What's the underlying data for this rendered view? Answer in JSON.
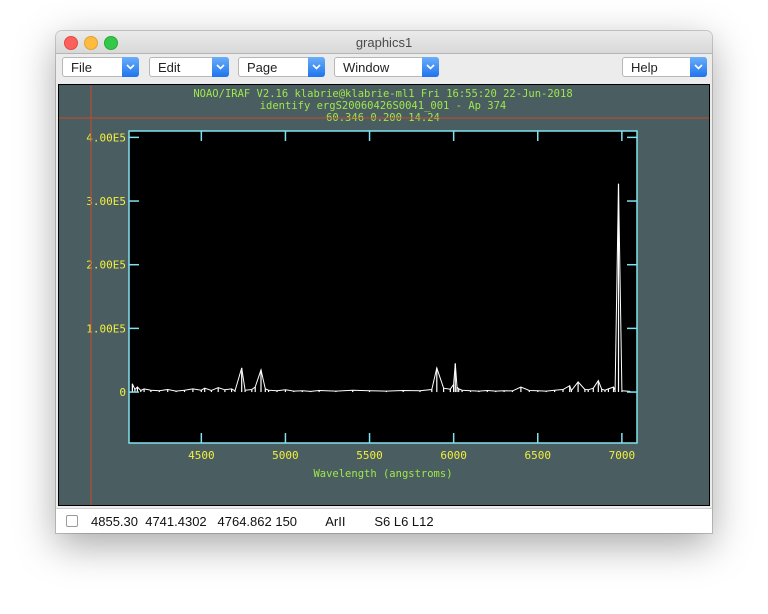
{
  "window": {
    "title": "graphics1"
  },
  "menus": [
    {
      "label": "File"
    },
    {
      "label": "Edit"
    },
    {
      "label": "Page"
    },
    {
      "label": "Window"
    },
    {
      "label": "Help"
    }
  ],
  "plot_header": {
    "line1": "NOAO/IRAF V2.16 klabrie@klabrie-ml1 Fri 16:55:20 22-Jun-2018",
    "line2": "identify ergS20060426S0041_001 - Ap 374",
    "line3": "60.346   0.200 14.24"
  },
  "colors": {
    "plot_background": "#4a5e61",
    "axes_frame": "#7fe3ef",
    "header_text": "#9fe84a",
    "tick_labels": "#f2ef3c",
    "spectrum": "#ffffff",
    "cursor": "#c44a2a"
  },
  "chart_data": {
    "type": "line",
    "xlabel": "Wavelength (angstroms)",
    "ylabel": "",
    "xlim": [
      4070,
      7090
    ],
    "ylim": [
      -80000,
      410000
    ],
    "x_ticks": [
      4500,
      5000,
      5500,
      6000,
      6500,
      7000
    ],
    "x_tick_labels": [
      "4500",
      "5000",
      "5500",
      "6000",
      "6500",
      "7000"
    ],
    "y_ticks": [
      0,
      100000,
      200000,
      300000,
      400000
    ],
    "y_tick_labels": [
      "0",
      "1.00E5",
      "2.00E5",
      "3.00E5",
      "4.00E5"
    ],
    "grid": false,
    "series": [
      {
        "x": [
          4090,
          4105,
          4120,
          4140,
          4160,
          4200,
          4250,
          4300,
          4350,
          4400,
          4450,
          4500,
          4520,
          4560,
          4600,
          4640,
          4680,
          4700,
          4740,
          4760,
          4800,
          4820,
          4855,
          4880,
          4900,
          4950,
          5000,
          5050,
          5100,
          5150,
          5200,
          5300,
          5400,
          5500,
          5600,
          5700,
          5800,
          5870,
          5900,
          5940,
          5980,
          6000,
          6010,
          6020,
          6030,
          6050,
          6100,
          6150,
          6200,
          6250,
          6300,
          6350,
          6400,
          6450,
          6500,
          6550,
          6600,
          6650,
          6690,
          6700,
          6740,
          6780,
          6800,
          6830,
          6860,
          6880,
          6900,
          6920,
          6950,
          6960,
          6980,
          7000,
          7050
        ],
        "y": [
          13000,
          4000,
          8000,
          2500,
          5000,
          3000,
          2000,
          4000,
          1500,
          3000,
          5000,
          3000,
          6000,
          2500,
          7000,
          3500,
          5000,
          2000,
          38000,
          3000,
          4000,
          8000,
          35000,
          5000,
          3000,
          2000,
          3500,
          1500,
          2000,
          1000,
          2500,
          1500,
          3000,
          2000,
          1500,
          2500,
          2000,
          4000,
          38000,
          6000,
          4500,
          12000,
          45000,
          8000,
          5000,
          3000,
          2000,
          1500,
          2500,
          1500,
          2000,
          1800,
          8000,
          2500,
          2000,
          1500,
          3000,
          4000,
          10000,
          2500,
          16000,
          4000,
          3500,
          6000,
          18000,
          4500,
          3000,
          5000,
          8000,
          3000,
          327000,
          2000,
          1000
        ]
      }
    ]
  },
  "status": {
    "text": "4855.30  4741.4302   4764.862 150        ArII        S6 L6 L12"
  }
}
